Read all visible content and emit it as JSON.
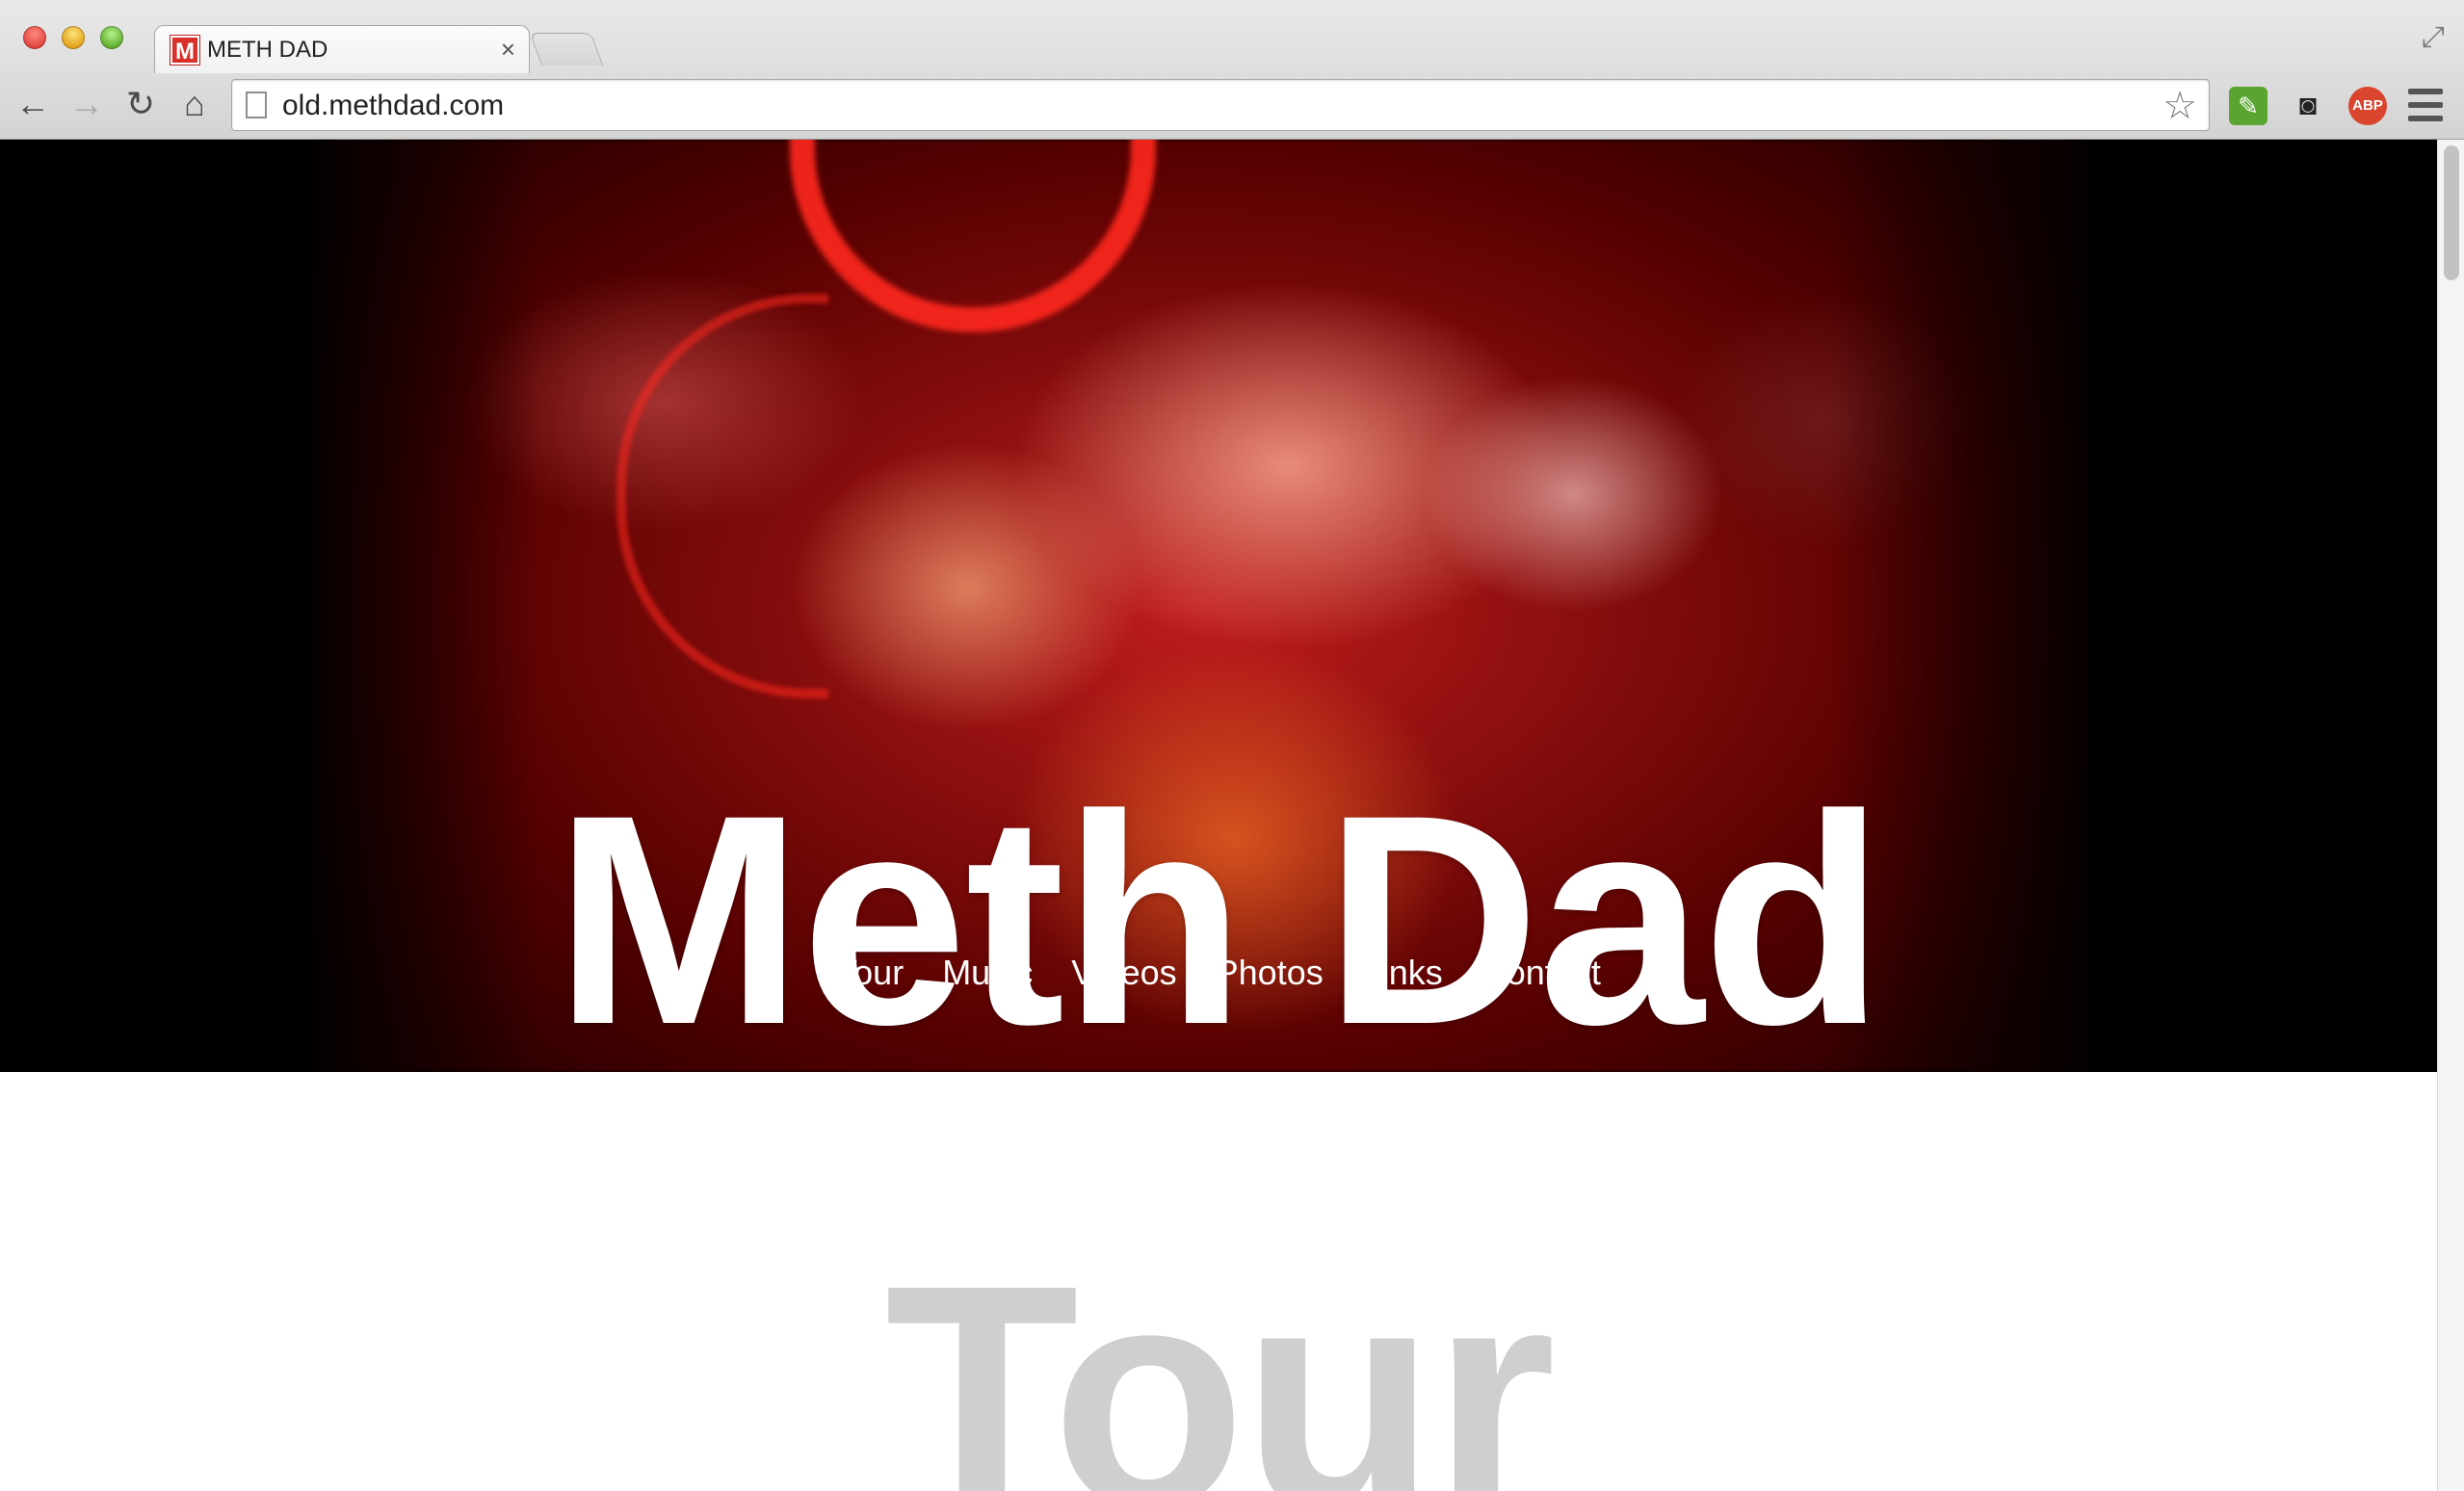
{
  "browser": {
    "tab_title": "METH DAD",
    "tab_favicon_letter": "M",
    "tab_close": "×",
    "url": "old.methdad.com",
    "extensions": {
      "evernote": "evernote-icon",
      "incognito": "mask-icon",
      "abp": "ABP"
    }
  },
  "hero": {
    "band_name": "Meth Dad",
    "nav": [
      "Tour",
      "Music",
      "Videos",
      "Photos",
      "Links",
      "Contact"
    ]
  },
  "section": {
    "title": "Tour"
  },
  "colors": {
    "accent_red": "#d9302a",
    "section_title_gray": "#cfcfcf"
  }
}
